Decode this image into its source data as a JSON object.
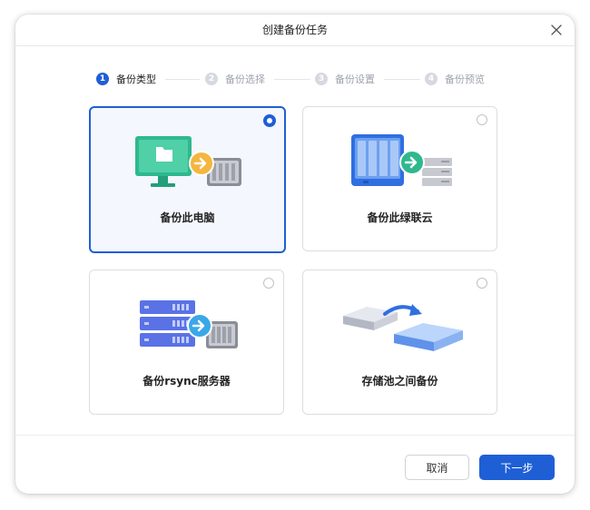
{
  "dialog": {
    "title": "创建备份任务"
  },
  "steps": [
    {
      "number": "1",
      "label": "备份类型",
      "active": true
    },
    {
      "number": "2",
      "label": "备份选择",
      "active": false
    },
    {
      "number": "3",
      "label": "备份设置",
      "active": false
    },
    {
      "number": "4",
      "label": "备份预览",
      "active": false
    }
  ],
  "options": [
    {
      "label": "备份此电脑",
      "selected": true,
      "icon": "computer-to-nas-icon"
    },
    {
      "label": "备份此绿联云",
      "selected": false,
      "icon": "nas-to-server-icon"
    },
    {
      "label": "备份rsync服务器",
      "selected": false,
      "icon": "rsync-server-to-nas-icon"
    },
    {
      "label": "存储池之间备份",
      "selected": false,
      "icon": "pool-to-pool-icon"
    }
  ],
  "footer": {
    "cancel_label": "取消",
    "next_label": "下一步"
  },
  "colors": {
    "accent": "#1f5fd6",
    "selected_bg": "#f4f7fd"
  }
}
